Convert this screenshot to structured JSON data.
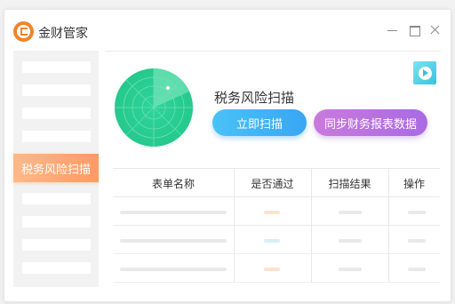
{
  "app": {
    "title": "金财管家",
    "logo_icon": "jincai-logo-icon"
  },
  "window_controls": [
    "minimize-icon",
    "maximize-icon",
    "close-icon"
  ],
  "sidebar": {
    "active_item": "税务风险扫描",
    "accent": "#fd9b63"
  },
  "scan": {
    "title": "税务风险扫描",
    "scan_button": "立即扫描",
    "sync_button": "同步财务报表数据",
    "radar_color": "#2fd39a",
    "video_icon": "play-video-icon"
  },
  "table": {
    "columns": [
      "表单名称",
      "是否通过",
      "扫描结果",
      "操作"
    ],
    "rows": [
      {
        "status_color": "#fde3cf"
      },
      {
        "status_color": "#d6f0f3"
      },
      {
        "status_color": "#fde3cf"
      }
    ]
  }
}
